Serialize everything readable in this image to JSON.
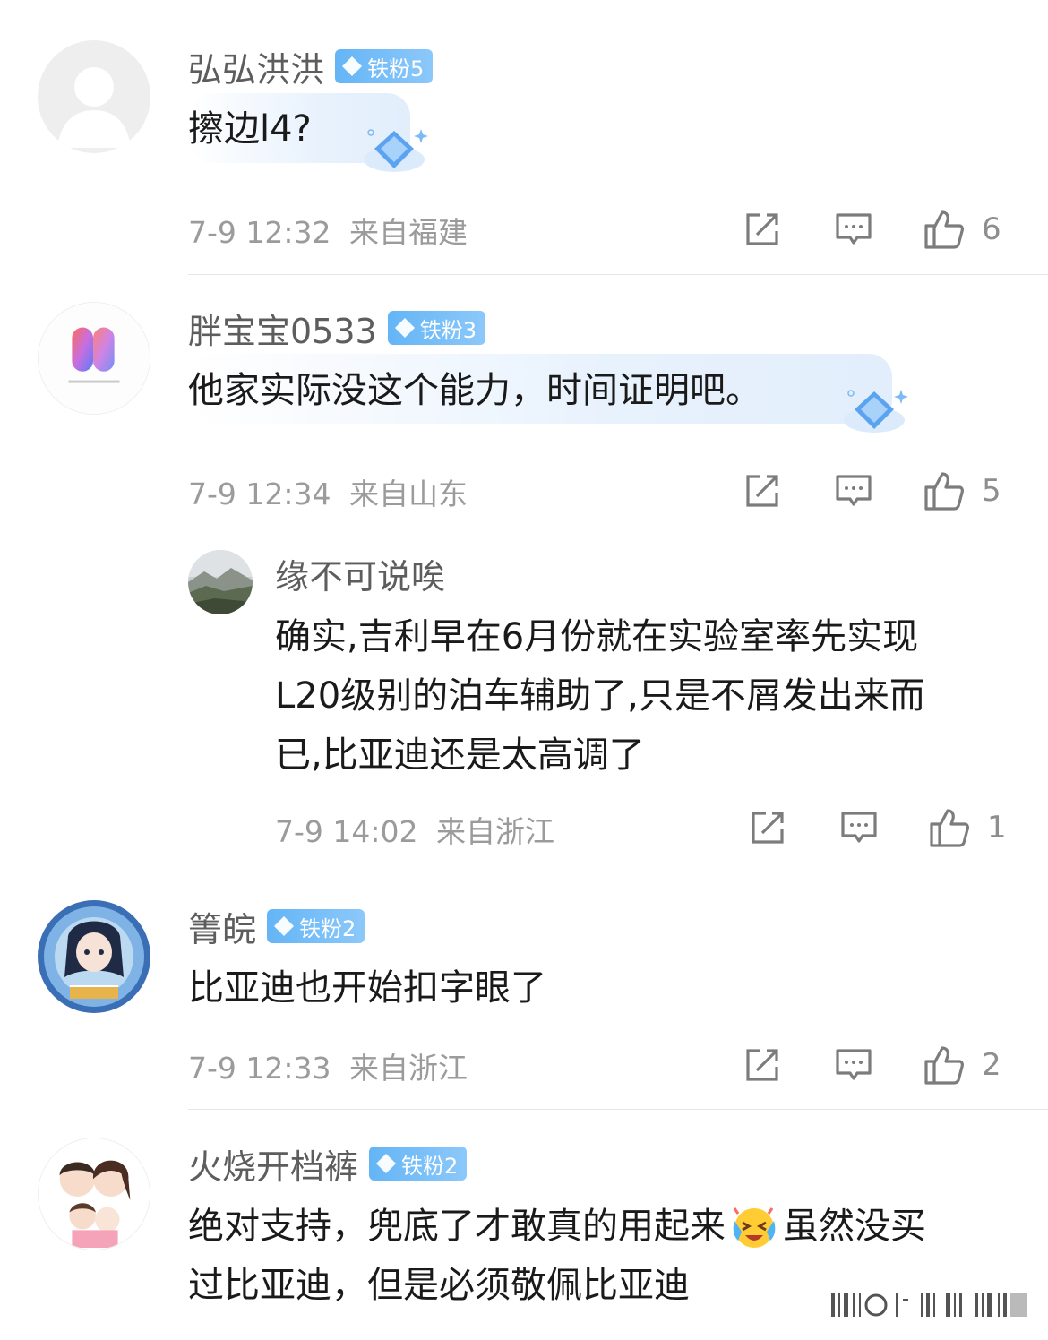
{
  "comments": [
    {
      "username": "弘弘洪洪",
      "badge": "铁粉5",
      "text": "擦边l4?",
      "time": "7-9 12:32",
      "location": "来自福建",
      "likes": "6",
      "avatar_icon": "default-person-avatar"
    },
    {
      "username": "胖宝宝0533",
      "badge": "铁粉3",
      "text": "他家实际没这个能力，时间证明吧。",
      "time": "7-9 12:34",
      "location": "来自山东",
      "likes": "5",
      "avatar_icon": "gradient-n-logo-avatar",
      "reply": {
        "username": "缘不可说唉",
        "text_lines": [
          "确实,吉利早在6月份就在实验室率先实现",
          "L20级别的泊车辅助了,只是不屑发出来而",
          "已,比亚迪还是太高调了"
        ],
        "time": "7-9 14:02",
        "location": "来自浙江",
        "likes": "1",
        "avatar_icon": "mountain-landscape-avatar"
      }
    },
    {
      "username": "箐皖",
      "badge": "铁粉2",
      "text": "比亚迪也开始扣字眼了",
      "time": "7-9 12:33",
      "location": "来自浙江",
      "likes": "2",
      "avatar_icon": "anime-birthday-avatar"
    },
    {
      "username": "火烧开档裤",
      "badge": "铁粉2",
      "text_lines": [
        "绝对支持，兜底了才敢真的用起来",
        "虽然没买",
        "过比亚迪，但是必须敬佩比亚迪"
      ],
      "emoji": "crying-laughing-emoji",
      "avatar_icon": "cartoon-family-avatar"
    }
  ],
  "colors": {
    "badge": "#64b5f6",
    "meta_text": "#9b9b9b",
    "divider": "#e6e6e6"
  }
}
